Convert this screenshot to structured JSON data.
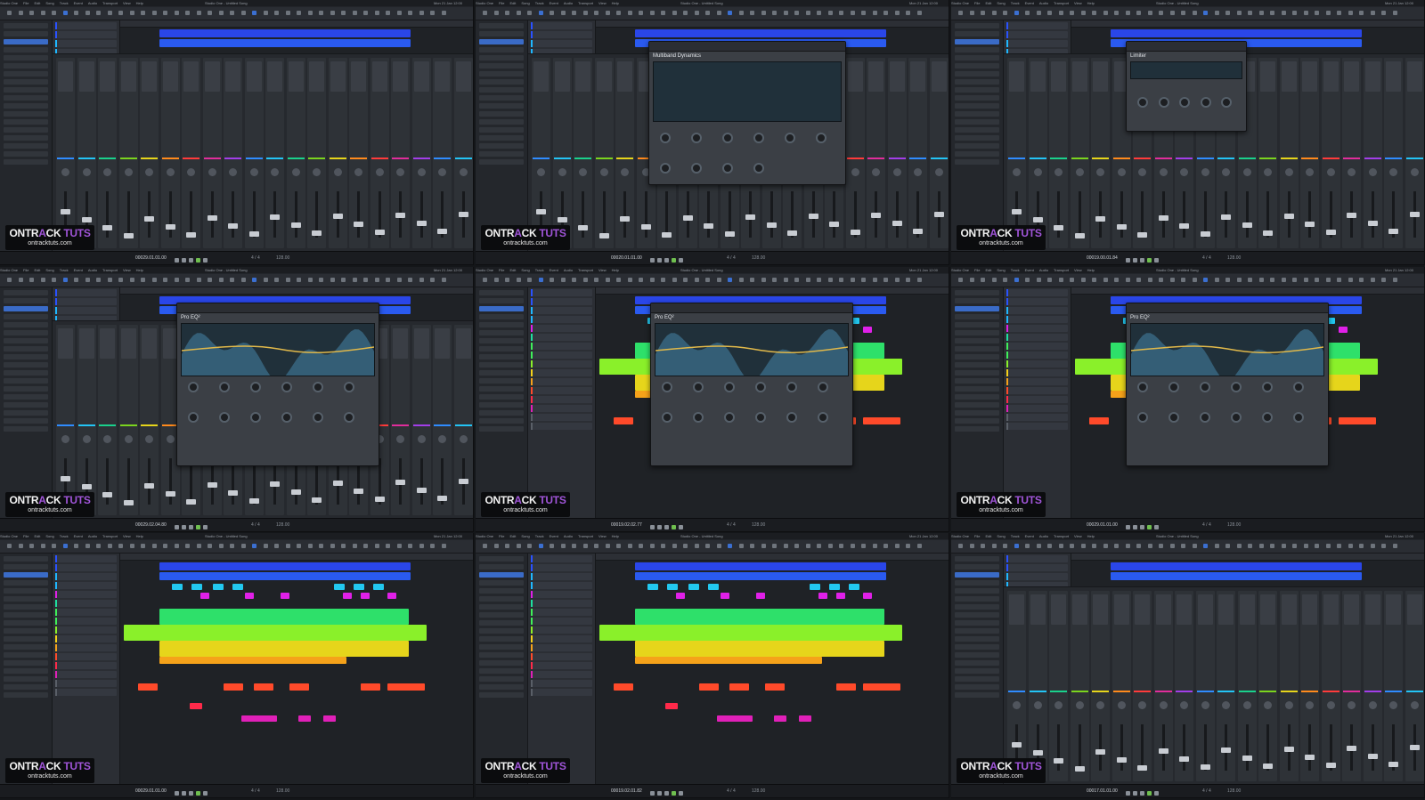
{
  "app": {
    "menu": [
      "Studio One",
      "File",
      "Edit",
      "Song",
      "Track",
      "Event",
      "Audio",
      "Transport",
      "View",
      "Help"
    ],
    "window_title": "Studio One - Untitled Song",
    "clock": "Mon 21 Jan 12:00"
  },
  "branding": {
    "part1": "ONTR",
    "accent": "A",
    "part2": "CK",
    "part3": "TUTS",
    "url": "ontracktuts.com"
  },
  "tiles": [
    {
      "view": "mixer",
      "timecode": "00029.01.01.00",
      "plugin": ""
    },
    {
      "view": "mixer",
      "timecode": "00020.01.01.00",
      "plugin": "Multiband Dynamics"
    },
    {
      "view": "mixer",
      "timecode": "00019.00.01.84",
      "plugin": "Limiter"
    },
    {
      "view": "mixer",
      "timecode": "00029.02.04.80",
      "plugin": "Pro EQ²"
    },
    {
      "view": "arrange",
      "timecode": "00019.02.02.77",
      "plugin": "Pro EQ²"
    },
    {
      "view": "arrange",
      "timecode": "00029.01.01.00",
      "plugin": "Pro EQ²"
    },
    {
      "view": "arrange",
      "timecode": "00029.01.01.00",
      "plugin": ""
    },
    {
      "view": "arrange",
      "timecode": "00019.02.01.82",
      "plugin": ""
    },
    {
      "view": "mixer",
      "timecode": "00017.01.01.00",
      "plugin": ""
    }
  ],
  "transport": {
    "time_signature": "4 / 4",
    "tempo": "128.00"
  },
  "colors": {
    "accent_blue": "#3b6fd1",
    "brand_purple": "#a055d8"
  }
}
